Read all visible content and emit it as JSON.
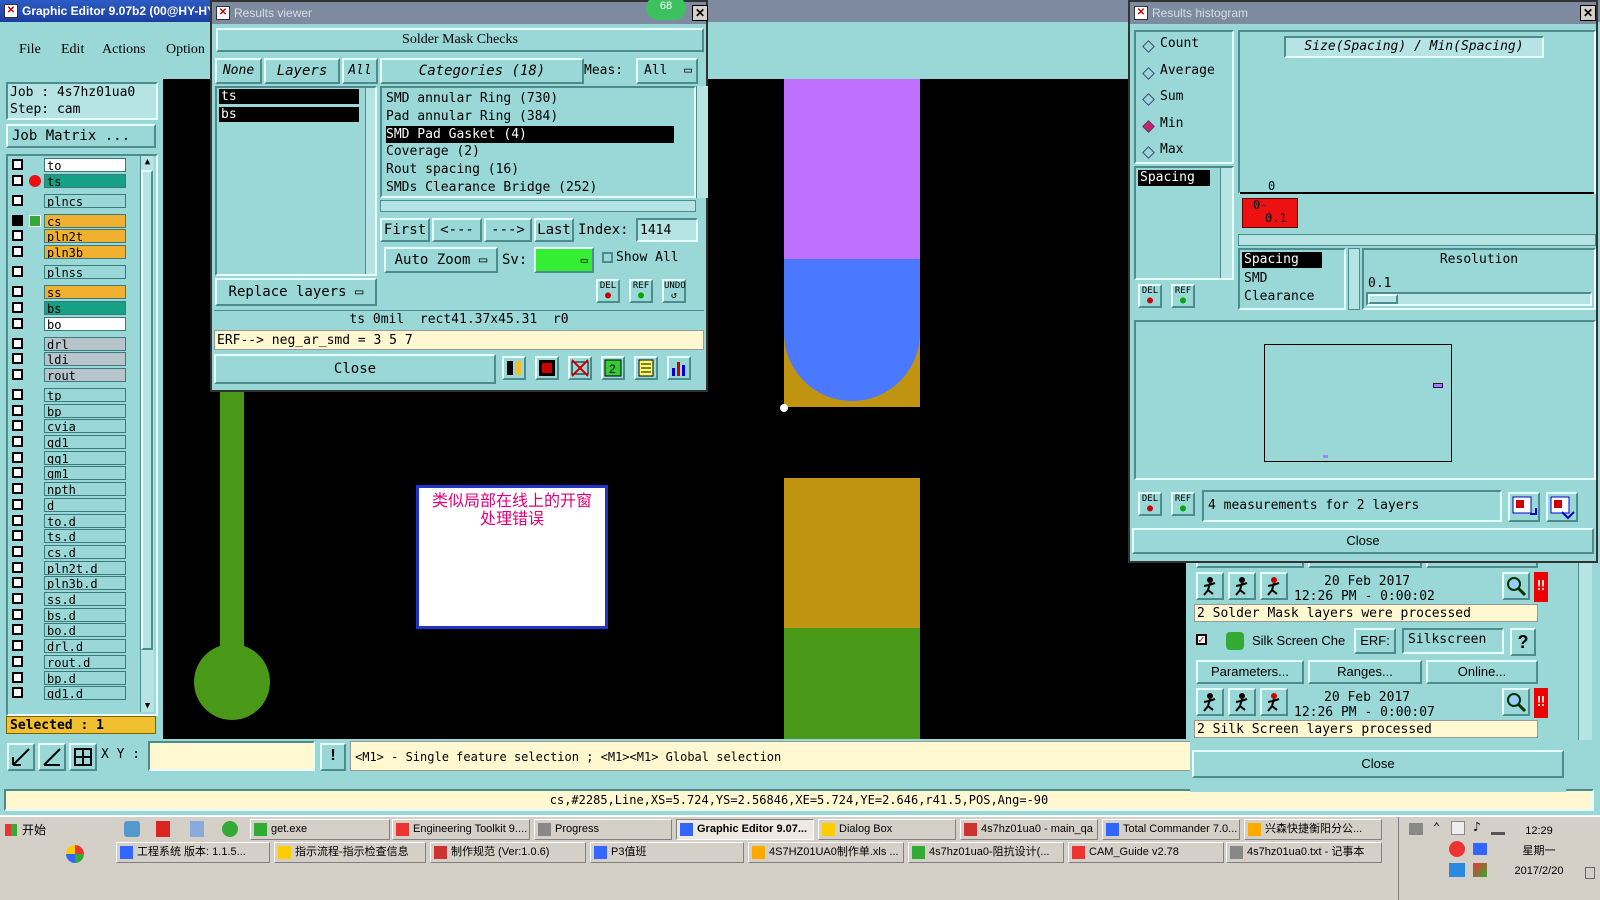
{
  "main_window": {
    "title": "Graphic Editor 9.07b2 (00@HY-HY",
    "menu": [
      "File",
      "Edit",
      "Actions",
      "Option"
    ],
    "job": "Job : 4s7hz01ua0",
    "step": "Step: cam",
    "job_matrix": "Job Matrix ...",
    "layers": [
      {
        "name": "to",
        "color": "#ffffff",
        "dot": false
      },
      {
        "name": "ts",
        "color": "#16a085",
        "dot": true
      },
      {
        "name": "plncs",
        "color": "#9ad8d8",
        "dot": false
      },
      {
        "name": "cs",
        "color": "#f0b030",
        "dot": false,
        "work": true
      },
      {
        "name": "pln2t",
        "color": "#f0b030",
        "dot": false
      },
      {
        "name": "pln3b",
        "color": "#f0b030",
        "dot": false
      },
      {
        "name": "plnss",
        "color": "#9ad8d8",
        "dot": false
      },
      {
        "name": "ss",
        "color": "#f0b030",
        "dot": false
      },
      {
        "name": "bs",
        "color": "#16a085",
        "dot": false
      },
      {
        "name": "bo",
        "color": "#ffffff",
        "dot": false
      },
      {
        "name": "drl",
        "color": "#b8c4cc",
        "dot": false
      },
      {
        "name": "ldi",
        "color": "#b8c4cc",
        "dot": false
      },
      {
        "name": "rout",
        "color": "#b8c4cc",
        "dot": false
      },
      {
        "name": "tp",
        "color": "#9ad8d8",
        "dot": false
      },
      {
        "name": "bp",
        "color": "#9ad8d8",
        "dot": false
      },
      {
        "name": "cvia",
        "color": "#9ad8d8",
        "dot": false
      },
      {
        "name": "gd1",
        "color": "#9ad8d8",
        "dot": false
      },
      {
        "name": "gg1",
        "color": "#9ad8d8",
        "dot": false
      },
      {
        "name": "gm1",
        "color": "#9ad8d8",
        "dot": false
      },
      {
        "name": "npth",
        "color": "#9ad8d8",
        "dot": false
      },
      {
        "name": "d",
        "color": "#9ad8d8",
        "dot": false
      },
      {
        "name": "to.d",
        "color": "#9ad8d8",
        "dot": false
      },
      {
        "name": "ts.d",
        "color": "#9ad8d8",
        "dot": false
      },
      {
        "name": "cs.d",
        "color": "#9ad8d8",
        "dot": false
      },
      {
        "name": "pln2t.d",
        "color": "#9ad8d8",
        "dot": false
      },
      {
        "name": "pln3b.d",
        "color": "#9ad8d8",
        "dot": false
      },
      {
        "name": "ss.d",
        "color": "#9ad8d8",
        "dot": false
      },
      {
        "name": "bs.d",
        "color": "#9ad8d8",
        "dot": false
      },
      {
        "name": "bo.d",
        "color": "#9ad8d8",
        "dot": false
      },
      {
        "name": "drl.d",
        "color": "#9ad8d8",
        "dot": false
      },
      {
        "name": "rout.d",
        "color": "#9ad8d8",
        "dot": false
      },
      {
        "name": "bp.d",
        "color": "#9ad8d8",
        "dot": false
      },
      {
        "name": "gd1.d",
        "color": "#9ad8d8",
        "dot": false
      }
    ],
    "selected": "Selected : 1",
    "xy_label": "X Y :",
    "xy_value": "",
    "hint": "<M1> - Single feature selection ; <M1><M1> Global selection",
    "status": "cs,#2285,Line,XS=5.724,YS=2.56846,XE=5.724,YE=2.646,r41.5,POS,Ang=-90",
    "annotation_line1": "类似局部在线上的开窗",
    "annotation_line2": "处理错误"
  },
  "results_viewer": {
    "title": "Results viewer",
    "badge": "68",
    "header": "Solder Mask Checks",
    "none": "None",
    "layers_btn": "Layers",
    "all": "All",
    "categories": "Categories (18)",
    "meas_label": "Meas:",
    "meas_value": "All",
    "layers": [
      "ts",
      "bs"
    ],
    "category_items": [
      "SMD annular Ring (730)",
      "Pad annular Ring (384)",
      "SMD Pad Gasket (4)",
      "Coverage (2)",
      "Rout spacing (16)",
      "SMDs Clearance Bridge (252)"
    ],
    "selected_category_index": 2,
    "first": "First",
    "prev": "<---",
    "next": "--->",
    "last": "Last",
    "index_label": "Index:",
    "index_value": "1414",
    "auto_zoom": "Auto Zoom",
    "sv": "Sv:",
    "show_all": "Show All",
    "replace_layers": "Replace layers",
    "del": "DEL",
    "ref": "REF",
    "undo": "UNDO",
    "info_line": "ts 0mil  rect41.37x45.31  r0",
    "erf_line": "ERF--> neg_ar_smd = 3 5 7",
    "close": "Close"
  },
  "histogram": {
    "title": "Results histogram",
    "modes": [
      "Count",
      "Average",
      "Sum",
      "Min",
      "Max"
    ],
    "selected_mode_index": 3,
    "formula": "Size(Spacing) / Min(Spacing)",
    "measure_list": [
      "Spacing"
    ],
    "axis_zero": "0",
    "bin_line1": "0-",
    "bin_line2": "0.1",
    "category_list": [
      "Spacing",
      "SMD",
      "Clearance"
    ],
    "resolution_label": "Resolution",
    "resolution_value": "0.1",
    "summary": "4 measurements for 2 layers",
    "del": "DEL",
    "ref": "REF",
    "close": "Close"
  },
  "checklist": {
    "params": "Parameters...",
    "ranges": "Ranges...",
    "online": "Online...",
    "run1_date": "20 Feb 2017",
    "run1_time": "12:26 PM - 0:00:02",
    "run1_msg": "2 Solder Mask layers were processed",
    "silk_name": "Silk Screen Che",
    "erf_label": "ERF:",
    "erf_value": "Silkscreen",
    "help": "?",
    "run2_date": "20 Feb 2017",
    "run2_time": "12:26 PM - 0:00:07",
    "run2_msg": "2 Silk Screen layers processed",
    "close": "Close"
  },
  "taskbar": {
    "start": "开始",
    "row1": [
      "get.exe",
      "Engineering Toolkit 9....",
      "Progress",
      "Graphic Editor 9.07...",
      "Dialog Box",
      "4s7hz01ua0 - main_qa",
      "Total Commander 7.0...",
      "兴森快捷衡阳分公..."
    ],
    "row2": [
      "工程系统  版本: 1.1.5...",
      "指示流程-指示检查信息",
      "制作规范 (Ver:1.0.6)",
      "P3值班",
      "4S7HZ01UA0制作单.xls ...",
      "4s7hz01ua0-阻抗设计(...",
      "CAM_Guide v2.78",
      "4s7hz01ua0.txt - 记事本"
    ],
    "time": "12:29",
    "weekday": "星期一",
    "date": "2017/2/20"
  },
  "colors": {
    "cyan": "#9ad8d8",
    "canvas": "#000000",
    "purple": "#c070ff",
    "blue": "#4a78ff",
    "gold": "#c09410",
    "green": "#4a9818",
    "annotation_text": "#e0007a",
    "title_active": "#1a3ea0"
  }
}
